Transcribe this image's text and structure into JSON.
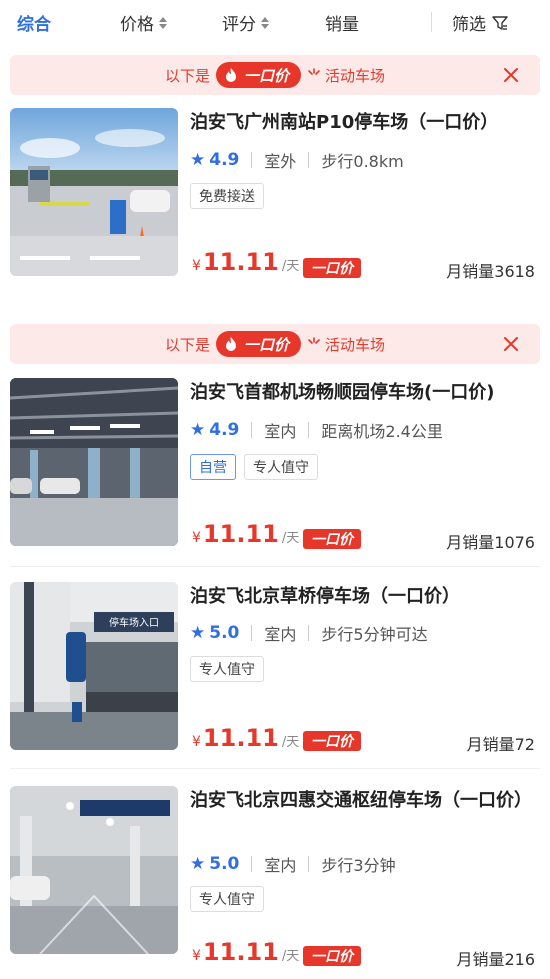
{
  "sort_bar": {
    "items": [
      "综合",
      "价格",
      "评分",
      "销量"
    ],
    "filter_label": "筛选"
  },
  "banner": {
    "pre": "以下是",
    "pill": "一口价",
    "post": "活动车场"
  },
  "listings": [
    {
      "title": "泊安飞广州南站P10停车场（一口价）",
      "rating": "4.9",
      "location_type": "室外",
      "distance": "步行0.8km",
      "tags": [
        "免费接送"
      ],
      "currency": "¥",
      "price": "11.11",
      "unit": "/天",
      "badge": "一口价",
      "sales": "月销量3618"
    },
    {
      "title": "泊安飞首都机场畅顺园停车场(一口价)",
      "rating": "4.9",
      "location_type": "室内",
      "distance": "距离机场2.4公里",
      "tags": [
        "自营",
        "专人值守"
      ],
      "currency": "¥",
      "price": "11.11",
      "unit": "/天",
      "badge": "一口价",
      "sales": "月销量1076"
    },
    {
      "title": "泊安飞北京草桥停车场（一口价）",
      "rating": "5.0",
      "location_type": "室内",
      "distance": "步行5分钟可达",
      "tags": [
        "专人值守"
      ],
      "currency": "¥",
      "price": "11.11",
      "unit": "/天",
      "badge": "一口价",
      "sales": "月销量72"
    },
    {
      "title": "泊安飞北京四惠交通枢纽停车场（一口价）",
      "rating": "5.0",
      "location_type": "室内",
      "distance": "步行3分钟",
      "tags": [
        "专人值守"
      ],
      "currency": "¥",
      "price": "11.11",
      "unit": "/天",
      "badge": "一口价",
      "sales": "月销量216"
    }
  ],
  "photo_signs": {
    "entrance": "停车场入口"
  },
  "colors": {
    "accent_blue": "#2f6fe0",
    "promo_red": "#e6372a",
    "banner_bg": "#fde9e7"
  },
  "icons": [
    "sort-updown-icon",
    "filter-funnel-icon",
    "flame-icon",
    "sparkle-icon",
    "close-icon",
    "star-icon"
  ]
}
